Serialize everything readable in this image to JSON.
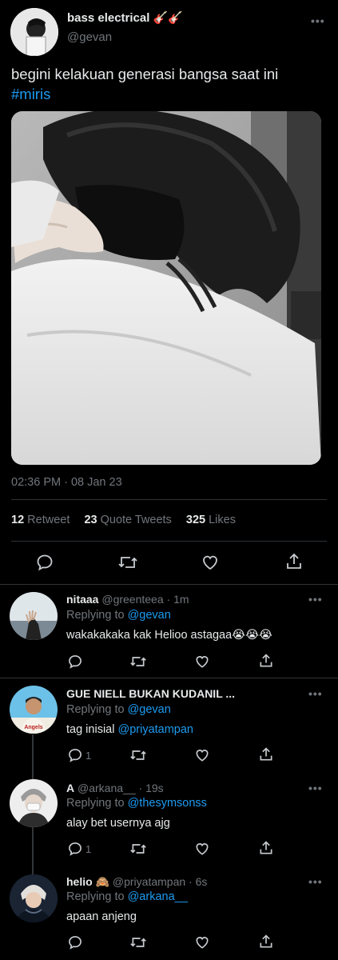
{
  "tweet": {
    "display_name": "bass electrical",
    "name_emoji": "🎸🎸",
    "handle": "@gevan",
    "text": "begini kelakuan generasi bangsa saat ini",
    "hashtag": "#miris",
    "timestamp": "02:36 PM · 08 Jan 23",
    "stats": {
      "retweets": "12",
      "retweets_label": "Retweet",
      "quotes": "23",
      "quotes_label": "Quote Tweets",
      "likes": "325",
      "likes_label": "Likes"
    }
  },
  "replies": [
    {
      "name": "nitaaa",
      "handle": "@greenteea",
      "sep": "·",
      "time": "1m",
      "replying_label": "Replying to",
      "replying_to": "@gevan",
      "text": "wakakakaka kak Helioo astagaa😭😭😭",
      "reply_count": ""
    },
    {
      "name": "GUE NIELL BUKAN KUDANIL ...",
      "replying_label": "Replying to",
      "replying_to": "@gevan",
      "text_prefix": "tag inisial",
      "mention": "@priyatampan",
      "reply_count": "1"
    },
    {
      "name": "A",
      "handle": "@arkana__",
      "sep": "·",
      "time": "19s",
      "replying_label": "Replying to",
      "replying_to": "@thesymsonss",
      "text": "alay bet usernya ajg",
      "reply_count": "1"
    },
    {
      "name": "helio 🙈",
      "handle": "@priyatampan",
      "sep": "·",
      "time": "6s",
      "replying_label": "Replying to",
      "replying_to": "@arkana__",
      "text": "apaan anjeng"
    }
  ],
  "colors": {
    "background": "#000000",
    "accent": "#1d9bf0",
    "muted": "#71767b",
    "divider": "#2f3336"
  }
}
